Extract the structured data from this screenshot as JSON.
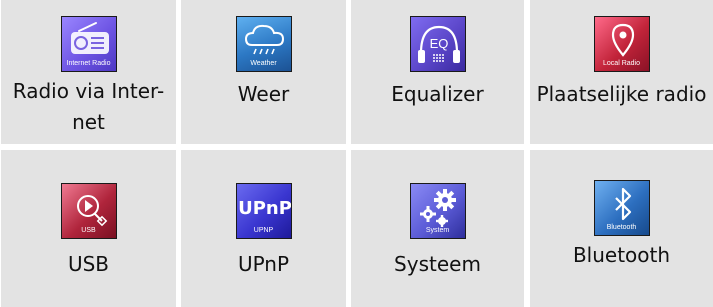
{
  "menu": {
    "items": [
      {
        "id": "internet-radio",
        "label": "Radio via Inter-\nnet",
        "icon": "radio-icon",
        "icon_caption": "Internet Radio",
        "color": "#7a63e0"
      },
      {
        "id": "weather",
        "label": "Weer",
        "icon": "cloud-rain-icon",
        "icon_caption": "Weather",
        "color": "#2c78c4"
      },
      {
        "id": "equalizer",
        "label": "Equalizer",
        "icon": "headphones-eq-icon",
        "icon_caption": "",
        "color": "#5b46c9"
      },
      {
        "id": "local-radio",
        "label": "Plaatselijke radio",
        "icon": "map-pin-icon",
        "icon_caption": "Local Radio",
        "color": "#c2243a"
      },
      {
        "id": "usb",
        "label": "USB",
        "icon": "usb-play-icon",
        "icon_caption": "USB",
        "color": "#b0253c"
      },
      {
        "id": "upnp",
        "label": "UPnP",
        "icon": "upnp-icon",
        "icon_caption": "UPNP",
        "color": "#3a36d0"
      },
      {
        "id": "system",
        "label": "Systeem",
        "icon": "gears-icon",
        "icon_caption": "System",
        "color": "#5b5bd6"
      },
      {
        "id": "bluetooth",
        "label": "Bluetooth",
        "icon": "bluetooth-icon",
        "icon_caption": "Bluetooth",
        "color": "#2d6fc0"
      }
    ]
  },
  "icons": {
    "upnp_text": "UPnP",
    "eq_text": "EQ"
  }
}
